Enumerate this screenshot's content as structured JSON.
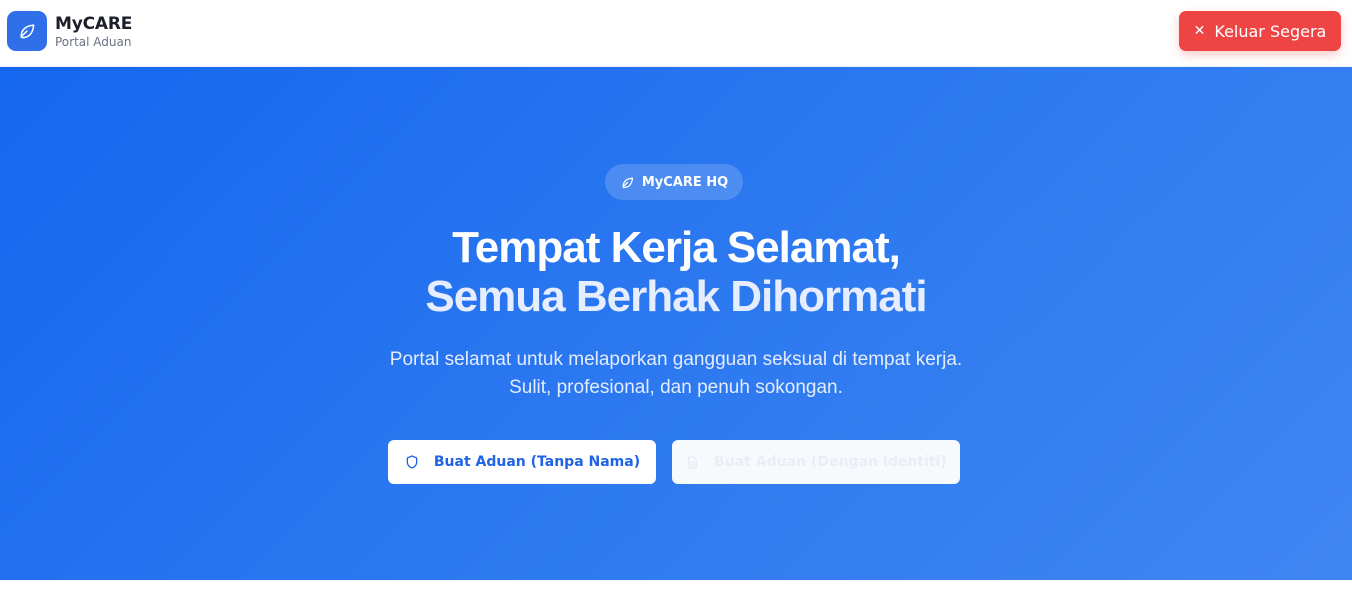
{
  "header": {
    "brand_title": "MyCARE",
    "brand_subtitle": "Portal Aduan",
    "logo_icon": "leaf-icon",
    "exit_button": {
      "label": "Keluar Segera",
      "icon": "close-icon",
      "color": "#ef4444"
    }
  },
  "hero": {
    "badge": {
      "label": "MyCARE HQ",
      "icon": "leaf-icon"
    },
    "headline_line1": "Tempat Kerja Selamat,",
    "headline_line2": "Semua Berhak Dihormati",
    "subtitle_line1": "Portal selamat untuk melaporkan gangguan seksual di tempat kerja.",
    "subtitle_line2": "Sulit, profesional, dan penuh sokongan.",
    "primary_button": {
      "label": "Buat Aduan (Tanpa Nama)",
      "icon": "shield-icon"
    },
    "secondary_button": {
      "label": "Buat Aduan (Dengan Identiti)",
      "icon": "document-icon"
    },
    "gradient_start": "#1667ef",
    "gradient_end": "#3f86f2"
  }
}
